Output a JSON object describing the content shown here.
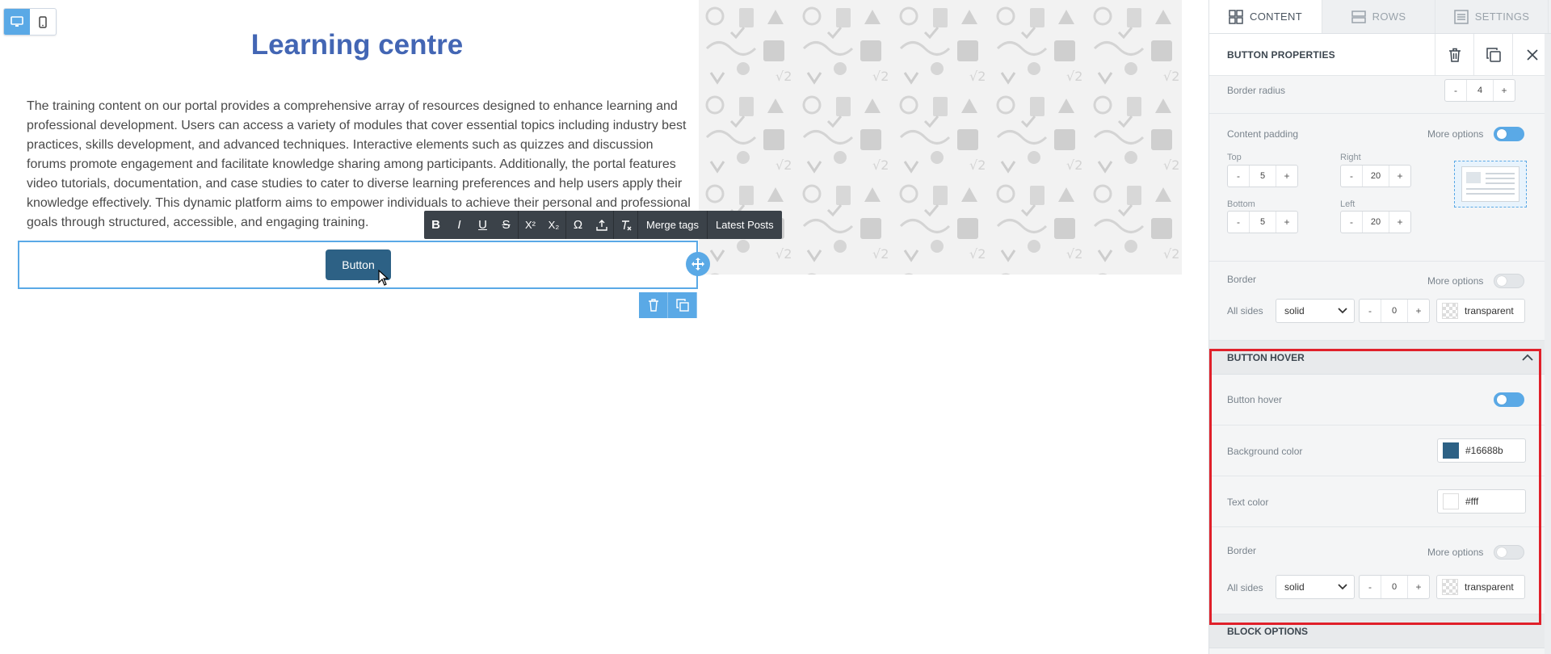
{
  "canvas": {
    "title": "Learning centre",
    "paragraph": "The training content on our portal provides a comprehensive array of resources designed to enhance learning and professional development. Users can access a variety of modules that cover essential topics including industry best practices, skills development, and advanced techniques. Interactive elements such as quizzes and discussion forums promote engagement and facilitate knowledge sharing among participants. Additionally, the portal features video tutorials, documentation, and case studies to cater to diverse learning preferences and help users apply their knowledge effectively. This dynamic platform aims to empower individuals to achieve their personal and professional goals through structured, accessible, and engaging training.",
    "button_label": "Button",
    "toolbar": {
      "bold": "B",
      "italic": "I",
      "underline": "U",
      "strike": "S",
      "superscript": "X²",
      "subscript": "X₂",
      "special_char": "Ω",
      "merge_tags": "Merge tags",
      "latest_posts": "Latest Posts"
    }
  },
  "panel": {
    "tabs": [
      {
        "label": "CONTENT"
      },
      {
        "label": "ROWS"
      },
      {
        "label": "SETTINGS"
      }
    ],
    "header_title": "BUTTON PROPERTIES",
    "border_radius": {
      "label": "Border radius",
      "value": "4"
    },
    "content_padding": {
      "label": "Content padding",
      "more_options": "More options",
      "top": {
        "label": "Top",
        "value": "5"
      },
      "right": {
        "label": "Right",
        "value": "20"
      },
      "bottom": {
        "label": "Bottom",
        "value": "5"
      },
      "left": {
        "label": "Left",
        "value": "20"
      }
    },
    "border": {
      "label": "Border",
      "more_options": "More options",
      "all_sides_label": "All sides",
      "style": "solid",
      "width": "0",
      "color": "transparent"
    },
    "button_hover": {
      "title": "BUTTON HOVER",
      "toggle_label": "Button hover",
      "bg_label": "Background color",
      "bg_value": "#16688b",
      "text_label": "Text color",
      "text_value": "#fff",
      "border_label": "Border",
      "more_options": "More options",
      "all_sides_label": "All sides",
      "border_style": "solid",
      "border_width": "0",
      "border_color": "transparent"
    },
    "block_options": "BLOCK OPTIONS",
    "stepper_minus": "-",
    "stepper_plus": "+"
  },
  "colors": {
    "accent": "#5aa9e6",
    "title_blue": "#4366b4",
    "button_bg": "#2d6185",
    "hover_bg": "#16688b",
    "highlight_red": "#e0202a"
  }
}
